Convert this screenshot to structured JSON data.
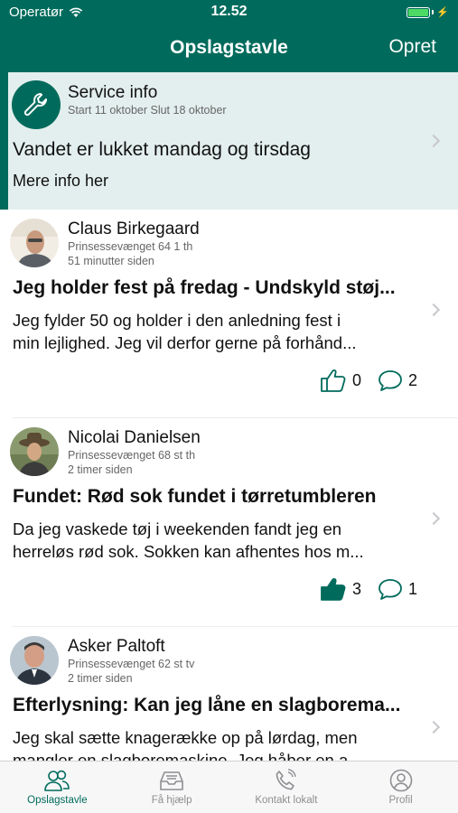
{
  "status_bar": {
    "carrier": "Operatør",
    "time": "12.52"
  },
  "nav": {
    "title": "Opslagstavle",
    "action": "Opret"
  },
  "service": {
    "author": "Service info",
    "meta": "Start 11 oktober Slut 18 oktober",
    "title": "Vandet er lukket mandag og tirsdag",
    "body": "Mere info her",
    "icon": "wrench-icon"
  },
  "posts": [
    {
      "author": "Claus Birkegaard",
      "address": "Prinsessevænget 64 1 th",
      "time": "51 minutter siden",
      "title": "Jeg holder fest på fredag - Undskyld støj...",
      "body_lines": [
        "Jeg fylder 50 og holder i den anledning fest i",
        "min lejlighed. Jeg vil derfor gerne på forhånd..."
      ],
      "likes": "0",
      "comments": "2",
      "liked": false
    },
    {
      "author": "Nicolai Danielsen",
      "address": "Prinsessevænget 68 st th",
      "time": "2 timer siden",
      "title": "Fundet: Rød sok fundet i tørretumbleren",
      "body_lines": [
        "Da jeg vaskede tøj i weekenden fandt jeg en",
        "herreløs rød sok. Sokken kan afhentes hos m..."
      ],
      "likes": "3",
      "comments": "1",
      "liked": true
    },
    {
      "author": "Asker Paltoft",
      "address": "Prinsessevænget 62 st tv",
      "time": "2 timer siden",
      "title": "Efterlysning: Kan jeg låne en slagborema...",
      "body_lines": [
        "Jeg skal sætte knagerække op på lørdag, men",
        "mangler en slagboremaskine. Jeg håber en a..."
      ],
      "likes": "",
      "comments": "",
      "liked": false
    }
  ],
  "tabs": [
    {
      "label": "Opslagstavle",
      "icon": "people-icon",
      "active": true
    },
    {
      "label": "Få hjælp",
      "icon": "inbox-tray-icon",
      "active": false
    },
    {
      "label": "Kontakt lokalt",
      "icon": "phone-icon",
      "active": false
    },
    {
      "label": "Profil",
      "icon": "profile-icon",
      "active": false
    }
  ],
  "colors": {
    "primary": "#006b5c",
    "service_bg": "#e3efee",
    "inactive_tab": "#8e8e93"
  }
}
